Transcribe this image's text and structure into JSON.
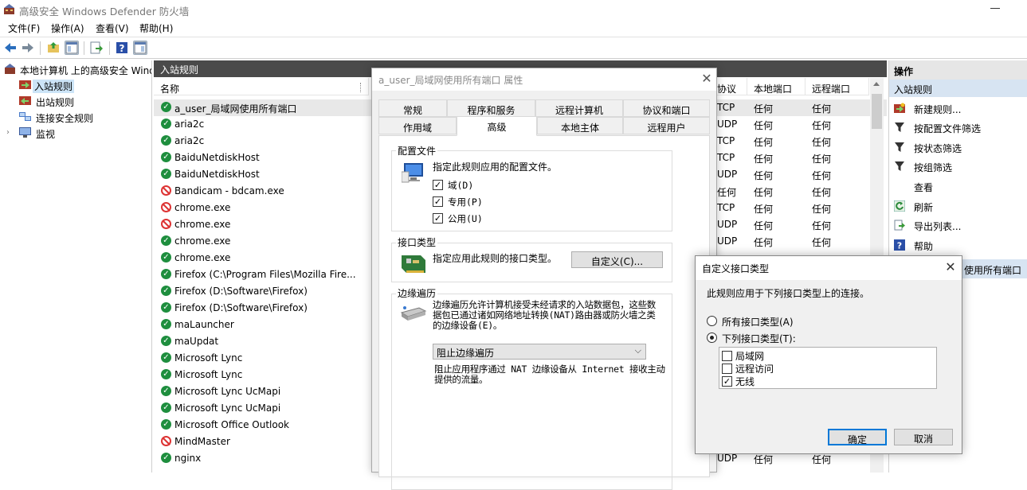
{
  "window": {
    "title": "高级安全 Windows Defender 防火墙"
  },
  "menu": [
    "文件(F)",
    "操作(A)",
    "查看(V)",
    "帮助(H)"
  ],
  "tree": {
    "root": "本地计算机 上的高级安全 Wind",
    "items": [
      "入站规则",
      "出站规则",
      "连接安全规则",
      "监视"
    ]
  },
  "list": {
    "header": "入站规则",
    "columns": [
      "名称",
      "协议",
      "本地端口",
      "远程端口"
    ],
    "rows": [
      {
        "name": "a_user_局域网使用所有端口",
        "status": "on",
        "proto": "TCP",
        "lport": "任何",
        "rport": "任何"
      },
      {
        "name": "aria2c",
        "status": "on",
        "proto": "UDP",
        "lport": "任何",
        "rport": "任何"
      },
      {
        "name": "aria2c",
        "status": "on",
        "proto": "TCP",
        "lport": "任何",
        "rport": "任何"
      },
      {
        "name": "BaiduNetdiskHost",
        "status": "on",
        "proto": "TCP",
        "lport": "任何",
        "rport": "任何"
      },
      {
        "name": "BaiduNetdiskHost",
        "status": "on",
        "proto": "UDP",
        "lport": "任何",
        "rport": "任何"
      },
      {
        "name": "Bandicam - bdcam.exe",
        "status": "block",
        "proto": "任何",
        "lport": "任何",
        "rport": "任何"
      },
      {
        "name": "chrome.exe",
        "status": "block",
        "proto": "TCP",
        "lport": "任何",
        "rport": "任何"
      },
      {
        "name": "chrome.exe",
        "status": "block",
        "proto": "UDP",
        "lport": "任何",
        "rport": "任何"
      },
      {
        "name": "chrome.exe",
        "status": "on",
        "proto": "UDP",
        "lport": "任何",
        "rport": "任何"
      },
      {
        "name": "chrome.exe",
        "status": "on",
        "proto": "",
        "lport": "",
        "rport": ""
      },
      {
        "name": "Firefox (C:\\Program Files\\Mozilla Fire...",
        "status": "on",
        "proto": "",
        "lport": "",
        "rport": ""
      },
      {
        "name": "Firefox (D:\\Software\\Firefox)",
        "status": "on",
        "proto": "",
        "lport": "",
        "rport": ""
      },
      {
        "name": "Firefox (D:\\Software\\Firefox)",
        "status": "on",
        "proto": "",
        "lport": "",
        "rport": ""
      },
      {
        "name": "maLauncher",
        "status": "on",
        "proto": "",
        "lport": "",
        "rport": ""
      },
      {
        "name": "maUpdat",
        "status": "on",
        "proto": "",
        "lport": "",
        "rport": ""
      },
      {
        "name": "Microsoft Lync",
        "status": "on",
        "proto": "",
        "lport": "",
        "rport": ""
      },
      {
        "name": "Microsoft Lync",
        "status": "on",
        "proto": "",
        "lport": "",
        "rport": ""
      },
      {
        "name": "Microsoft Lync UcMapi",
        "status": "on",
        "proto": "",
        "lport": "",
        "rport": ""
      },
      {
        "name": "Microsoft Lync UcMapi",
        "status": "on",
        "proto": "",
        "lport": "",
        "rport": ""
      },
      {
        "name": "Microsoft Office Outlook",
        "status": "on",
        "proto": "",
        "lport": "",
        "rport": ""
      },
      {
        "name": "MindMaster",
        "status": "block",
        "proto": "",
        "lport": "",
        "rport": ""
      },
      {
        "name": "nginx",
        "status": "on",
        "proto": "UDP",
        "lport": "任何",
        "rport": "任何"
      }
    ]
  },
  "actions": {
    "header": "操作",
    "section": "入站规则",
    "items": [
      "新建规则...",
      "按配置文件筛选",
      "按状态筛选",
      "按组筛选",
      "查看",
      "刷新",
      "导出列表...",
      "帮助"
    ],
    "section2": "使用所有端口"
  },
  "props": {
    "title": "a_user_局域网使用所有端口 属性",
    "tabs_row1": [
      "常规",
      "程序和服务",
      "远程计算机",
      "协议和端口"
    ],
    "tabs_row2": [
      "作用域",
      "高级",
      "本地主体",
      "远程用户"
    ],
    "profile_group": "配置文件",
    "profile_desc": "指定此规则应用的配置文件。",
    "profiles": [
      "域(D)",
      "专用(P)",
      "公用(U)"
    ],
    "iface_group": "接口类型",
    "iface_desc": "指定应用此规则的接口类型。",
    "iface_button": "自定义(C)...",
    "edge_group": "边缘遍历",
    "edge_desc": "边缘遍历允许计算机接受未经请求的入站数据包，这些数据包已通过诸如网络地址转换(NAT)路由器或防火墙之类的边缘设备(E)。",
    "edge_select": "阻止边缘遍历",
    "edge_note": "阻止应用程序通过 NAT 边缘设备从 Internet 接收主动提供的流量。"
  },
  "iface_dialog": {
    "title": "自定义接口类型",
    "desc": "此规则应用于下列接口类型上的连接。",
    "radio_all": "所有接口类型(A)",
    "radio_some": "下列接口类型(T):",
    "types": [
      {
        "label": "局域网",
        "checked": false
      },
      {
        "label": "远程访问",
        "checked": false
      },
      {
        "label": "无线",
        "checked": true
      }
    ],
    "ok": "确定",
    "cancel": "取消"
  }
}
